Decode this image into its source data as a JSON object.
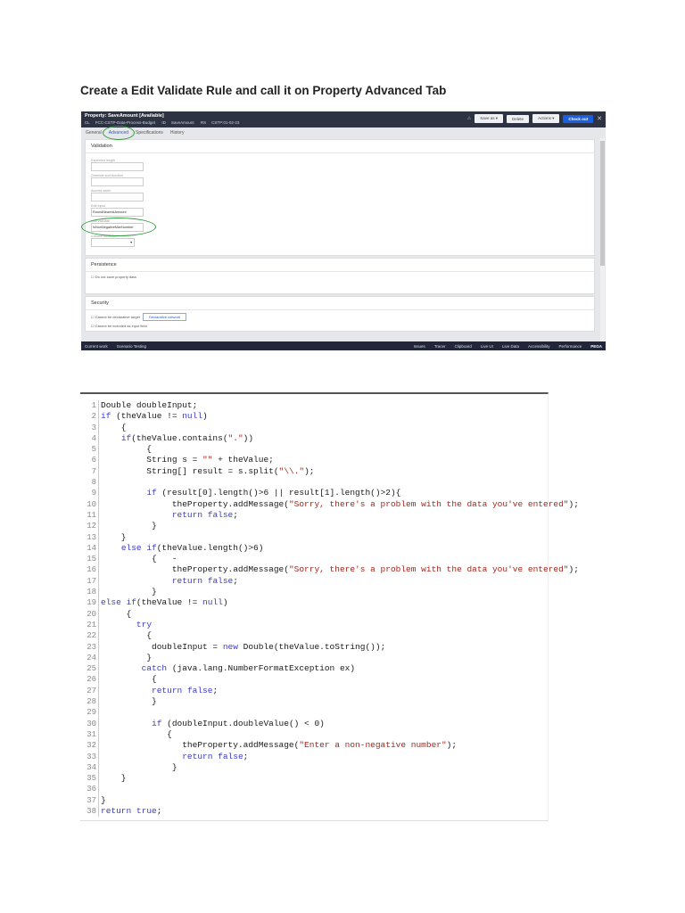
{
  "title": "Create a Edit Validate Rule and call it on Property Advanced Tab",
  "screenshot": {
    "header_title": "Property: SaveAmount [Available]",
    "class_label": "CL",
    "class_value": "FCC-CSTP-Data-Process-Budget",
    "id_label": "ID",
    "id_value": "SaveAmount",
    "rs_label": "RS",
    "rs_value": "CSTP:01-02-23",
    "buttons": {
      "save_as": "Save as",
      "delete": "Delete",
      "actions": "Actions",
      "check_out": "Check out",
      "close": "✕"
    },
    "tabs": [
      "General",
      "Advanced",
      "Specifications",
      "History"
    ],
    "validation": {
      "heading": "Validation",
      "fields": [
        {
          "label": "Expected length",
          "value": ""
        },
        {
          "label": "Override sort function",
          "value": ""
        },
        {
          "label": "Access when",
          "value": ""
        },
        {
          "label": "Edit input",
          "value": "RoundNearestAmount"
        },
        {
          "label": "Use validate",
          "value": "IsNonNegativeMaxNumber"
        },
        {
          "label": "Column inclusion",
          "value": ""
        }
      ]
    },
    "persistence": {
      "heading": "Persistence",
      "checkbox": "Do not save property data"
    },
    "security": {
      "heading": "Security",
      "checkbox": "Cannot be declarative target",
      "network_button": "Declarative network",
      "checkbox2": "Cannot be included as input field"
    },
    "footer": {
      "left": [
        "Current work",
        "Scenario Testing"
      ],
      "right": [
        "Issues",
        "Tracer",
        "Clipboard",
        "Live UI",
        "Live Data",
        "Accessibility",
        "Performance"
      ],
      "brand": "PEGA"
    }
  },
  "code": {
    "lines": [
      "Double doubleInput;",
      "if (theValue != null)",
      "    {",
      "    if(theValue.contains(\".\"))",
      "         {",
      "         String s = \"\" + theValue;",
      "         String[] result = s.split(\"\\\\.\");",
      "",
      "         if (result[0].length()>6 || result[1].length()>2){",
      "              theProperty.addMessage(\"Sorry, there's a problem with the data you've entered\");",
      "              return false;",
      "          }",
      "    }",
      "    else if(theValue.length()>6)",
      "          {   -",
      "              theProperty.addMessage(\"Sorry, there's a problem with the data you've entered\");",
      "              return false;",
      "          }",
      "else if(theValue != null)",
      "     {",
      "       try",
      "         {",
      "          doubleInput = new Double(theValue.toString());",
      "         }",
      "        catch (java.lang.NumberFormatException ex)",
      "          {",
      "          return false;",
      "          }",
      "",
      "          if (doubleInput.doubleValue() < 0)",
      "             {",
      "                theProperty.addMessage(\"Enter a non-negative number\");",
      "                return false;",
      "              }",
      "    }",
      "",
      "}",
      "return true;"
    ]
  }
}
